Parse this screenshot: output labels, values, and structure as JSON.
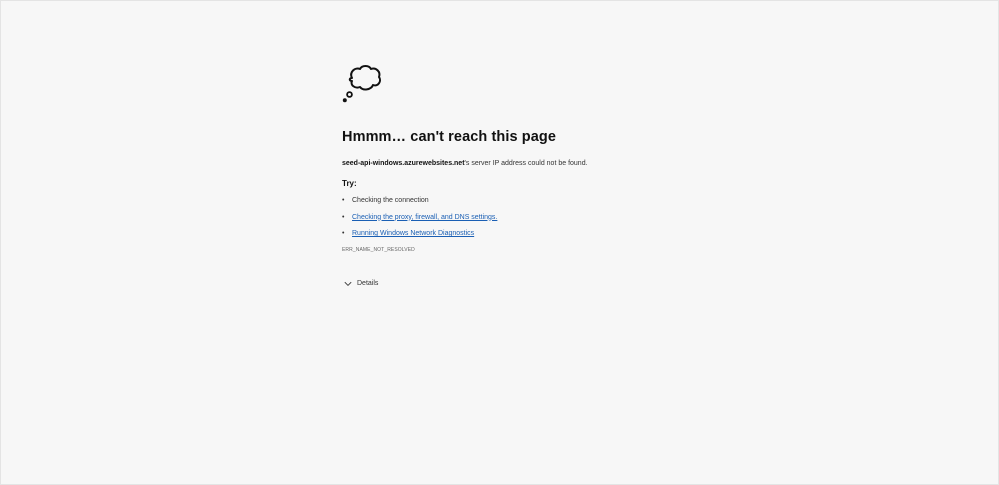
{
  "error_page": {
    "title": "Hmmm… can't reach this page",
    "host": "seed-api-windows.azurewebsites.net",
    "message_suffix": "'s server IP address could not be found.",
    "try_label": "Try:",
    "suggestions": [
      {
        "label": "Checking the connection",
        "is_link": false
      },
      {
        "label": "Checking the proxy, firewall, and DNS settings.",
        "is_link": true
      },
      {
        "label": "Running Windows Network Diagnostics",
        "is_link": true
      }
    ],
    "error_code": "ERR_NAME_NOT_RESOLVED",
    "details_label": "Details"
  },
  "icons": {
    "header": "thought-cloud-icon",
    "details": "chevron-down-icon"
  },
  "colors": {
    "background": "#f7f7f7",
    "link": "#1a5fb4",
    "text": "#1b1b1b"
  }
}
